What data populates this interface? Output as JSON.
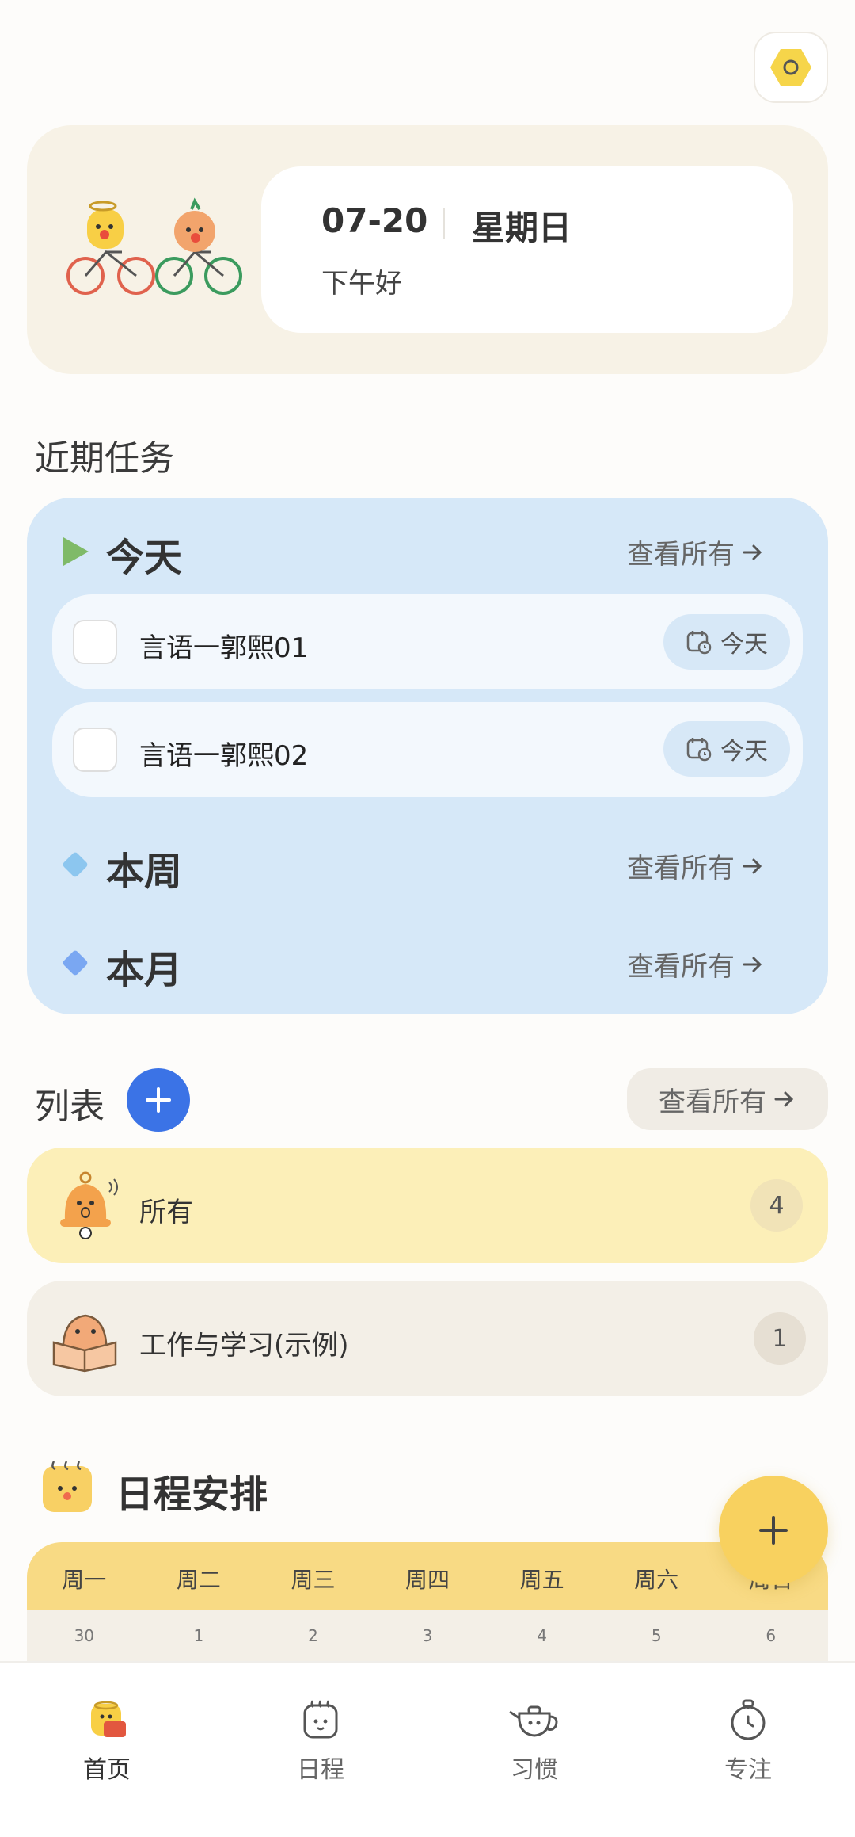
{
  "greeting": {
    "date": "07-20",
    "weekday": "星期日",
    "hello": "下午好"
  },
  "recent": {
    "title": "近期任务",
    "view_all": "查看所有",
    "today": {
      "label": "今天",
      "tasks": [
        {
          "text": "言语一郭熙01",
          "chip": "今天"
        },
        {
          "text": "言语一郭熙02",
          "chip": "今天"
        }
      ]
    },
    "week": {
      "label": "本周"
    },
    "month": {
      "label": "本月"
    }
  },
  "lists": {
    "title": "列表",
    "view_all": "查看所有",
    "items": [
      {
        "label": "所有",
        "count": "4"
      },
      {
        "label": "工作与学习(示例)",
        "count": "1"
      }
    ]
  },
  "schedule": {
    "title": "日程安排",
    "weekdays": [
      "周一",
      "周二",
      "周三",
      "周四",
      "周五",
      "周六",
      "周日"
    ],
    "dates": [
      "30",
      "1",
      "2",
      "3",
      "4",
      "5",
      "6"
    ]
  },
  "nav": [
    {
      "label": "首页",
      "icon": "home-icon",
      "active": true
    },
    {
      "label": "日程",
      "icon": "calendar-icon",
      "active": false
    },
    {
      "label": "习惯",
      "icon": "teapot-icon",
      "active": false
    },
    {
      "label": "专注",
      "icon": "timer-icon",
      "active": false
    }
  ],
  "colors": {
    "accent_blue": "#3b73e6",
    "fab_yellow": "#f8d15f",
    "tasks_bg": "#d6e8f8",
    "list_all_bg": "#fcefb8",
    "list_work_bg": "#f3efe7"
  }
}
